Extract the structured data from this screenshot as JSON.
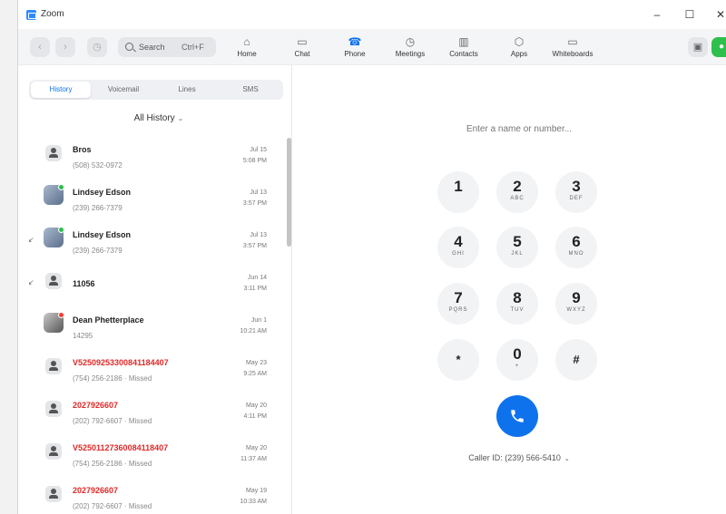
{
  "window": {
    "title": "Zoom",
    "minimize": "–",
    "maximize": "☐",
    "close": "✕"
  },
  "toolbar": {
    "search_label": "Search",
    "search_shortcut": "Ctrl+F",
    "tabs": [
      {
        "label": "Home",
        "icon": "home-icon",
        "glyph": "⌂"
      },
      {
        "label": "Chat",
        "icon": "chat-icon",
        "glyph": "▭"
      },
      {
        "label": "Phone",
        "icon": "phone-icon",
        "glyph": "☎"
      },
      {
        "label": "Meetings",
        "icon": "clock-icon",
        "glyph": "◷"
      },
      {
        "label": "Contacts",
        "icon": "contacts-icon",
        "glyph": "▥"
      },
      {
        "label": "Apps",
        "icon": "apps-icon",
        "glyph": "⬡"
      },
      {
        "label": "Whiteboards",
        "icon": "whiteboard-icon",
        "glyph": "▭"
      }
    ],
    "active_tab": "Phone",
    "accent": "#0e72ed"
  },
  "subtabs": [
    "History",
    "Voicemail",
    "Lines",
    "SMS"
  ],
  "active_subtab": "History",
  "filter": {
    "label": "All History",
    "chevron": "⌄"
  },
  "calls": [
    {
      "name": "Bros",
      "sub": "(508) 532-0972",
      "date": "Jul 15",
      "time": "5:08 PM",
      "missed": false,
      "avatar": "default",
      "dir": ""
    },
    {
      "name": "Lindsey Edson",
      "sub": "(239) 266-7379",
      "date": "Jul 13",
      "time": "3:57 PM",
      "missed": false,
      "avatar": "photo",
      "presence": "green",
      "dir": ""
    },
    {
      "name": "Lindsey Edson",
      "sub": "(239) 266-7379",
      "date": "Jul 13",
      "time": "3:57 PM",
      "missed": false,
      "avatar": "photo",
      "presence": "green",
      "dir": "↙"
    },
    {
      "name": "11056",
      "sub": "",
      "date": "Jun 14",
      "time": "3:11 PM",
      "missed": false,
      "avatar": "default",
      "dir": "↙"
    },
    {
      "name": "Dean Phetterplace",
      "sub": "14295",
      "date": "Jun 1",
      "time": "10:21 AM",
      "missed": false,
      "avatar": "photo2",
      "presence": "red",
      "dir": ""
    },
    {
      "name": "V52509253300841184407",
      "sub": "(754) 256-2186 · Missed",
      "date": "May 23",
      "time": "9:25 AM",
      "missed": true,
      "avatar": "default",
      "dir": ""
    },
    {
      "name": "2027926607",
      "sub": "(202) 792-6607 · Missed",
      "date": "May 20",
      "time": "4:11 PM",
      "missed": true,
      "avatar": "default",
      "dir": ""
    },
    {
      "name": "V52501127360084118407",
      "sub": "(754) 256-2186 · Missed",
      "date": "May 20",
      "time": "11:37 AM",
      "missed": true,
      "avatar": "default",
      "dir": ""
    },
    {
      "name": "2027926607",
      "sub": "(202) 792-6607 · Missed",
      "date": "May 19",
      "time": "10:33 AM",
      "missed": true,
      "avatar": "default",
      "dir": ""
    }
  ],
  "dialpad": {
    "placeholder": "Enter a name or number...",
    "keys": [
      {
        "d": "1",
        "l": ""
      },
      {
        "d": "2",
        "l": "ABC"
      },
      {
        "d": "3",
        "l": "DEF"
      },
      {
        "d": "4",
        "l": "GHI"
      },
      {
        "d": "5",
        "l": "JKL"
      },
      {
        "d": "6",
        "l": "MNO"
      },
      {
        "d": "7",
        "l": "PQRS"
      },
      {
        "d": "8",
        "l": "TUV"
      },
      {
        "d": "9",
        "l": "WXYZ"
      },
      {
        "d": "*",
        "l": ""
      },
      {
        "d": "0",
        "l": "+"
      },
      {
        "d": "#",
        "l": ""
      }
    ],
    "caller_id": "Caller ID: (239) 566-5410",
    "caller_chevron": "⌄"
  }
}
